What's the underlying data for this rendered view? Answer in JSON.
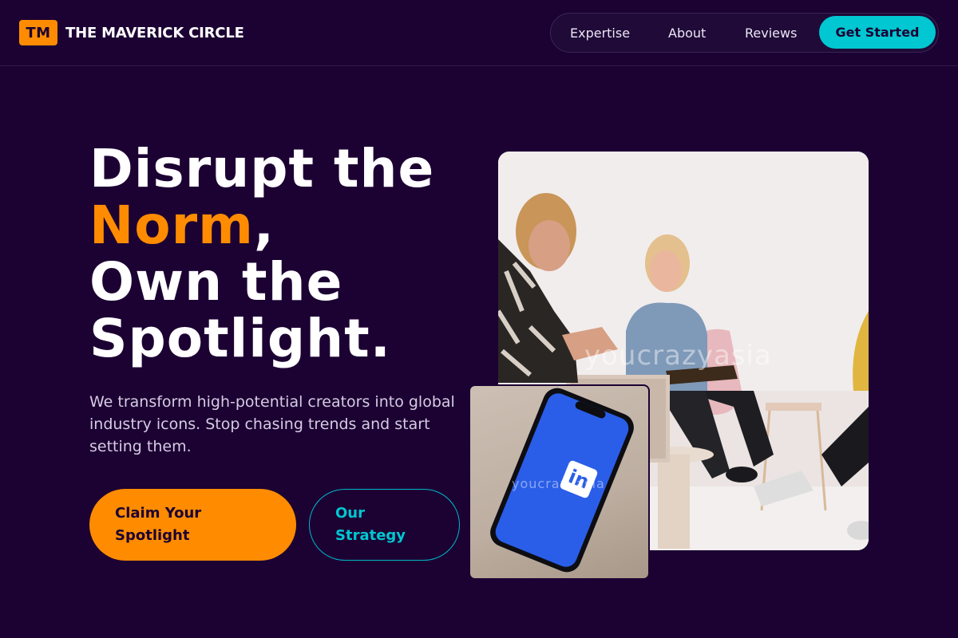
{
  "brand": {
    "mark": "TM",
    "name": "THE MAVERICK CIRCLE"
  },
  "nav": {
    "items": [
      "Expertise",
      "About",
      "Reviews"
    ],
    "cta": "Get Started"
  },
  "hero": {
    "title_line1": "Disrupt the",
    "title_accent": "Norm",
    "title_comma": ",",
    "title_line3": "Own the",
    "title_line4": "Spotlight.",
    "subtitle": "We transform high-potential creators into global industry icons. Stop chasing trends and start setting them.",
    "primary_button": "Claim Your Spotlight",
    "secondary_button": "Our Strategy"
  },
  "images": {
    "main_photo_watermark": "youcrazyasia",
    "phone_photo_watermark": "youcrazyasia",
    "phone_logo": "in"
  },
  "colors": {
    "background": "#1c0133",
    "accent_orange": "#ff8c00",
    "accent_cyan": "#00c7d1",
    "linkedin_blue": "#2a5ee8"
  }
}
